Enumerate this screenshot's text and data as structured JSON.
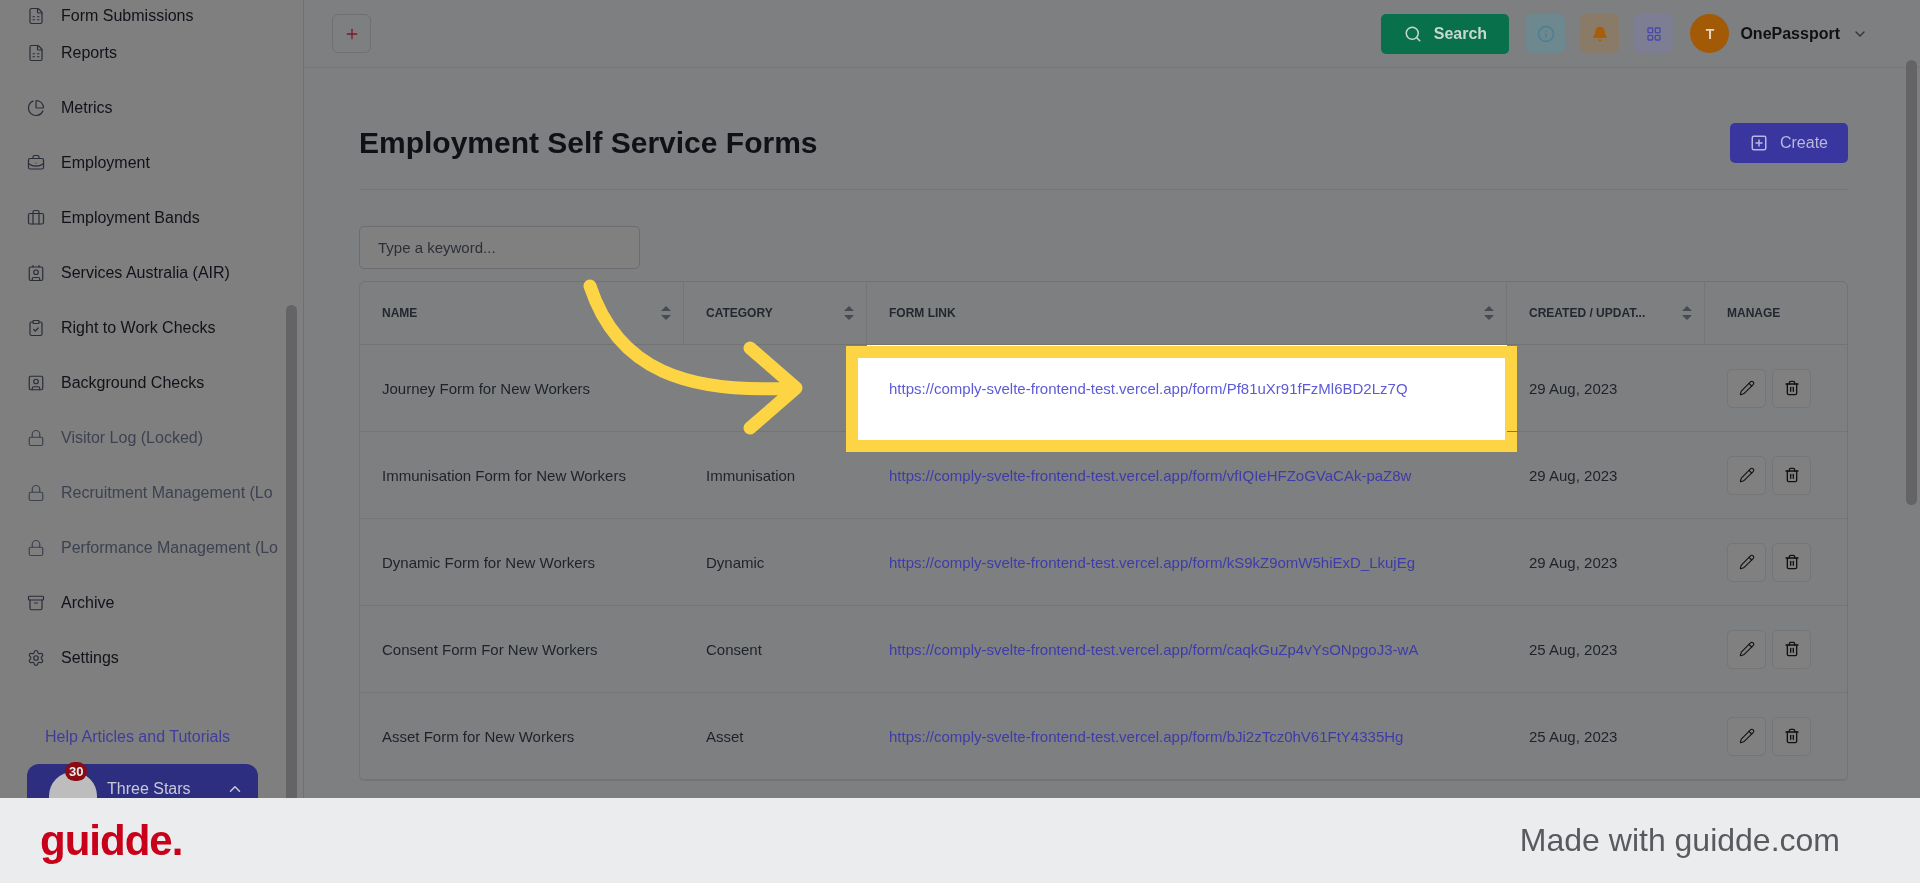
{
  "sidebar": {
    "items": [
      {
        "label": "Form Submissions",
        "locked": false
      },
      {
        "label": "Reports",
        "locked": false
      },
      {
        "label": "Metrics",
        "locked": false
      },
      {
        "label": "Employment",
        "locked": false
      },
      {
        "label": "Employment Bands",
        "locked": false
      },
      {
        "label": "Services Australia (AIR)",
        "locked": false
      },
      {
        "label": "Right to Work Checks",
        "locked": false
      },
      {
        "label": "Background Checks",
        "locked": false
      },
      {
        "label": "Visitor Log (Locked)",
        "locked": true
      },
      {
        "label": "Recruitment Management (Lo",
        "locked": true
      },
      {
        "label": "Performance Management (Lo",
        "locked": true
      },
      {
        "label": "Archive",
        "locked": false
      },
      {
        "label": "Settings",
        "locked": false
      }
    ],
    "help_link": "Help Articles and Tutorials",
    "promo": {
      "badge": "30",
      "title": "Three Stars"
    }
  },
  "topbar": {
    "search_label": "Search",
    "user": {
      "initial": "T",
      "name": "OnePassport"
    }
  },
  "page": {
    "title": "Employment Self Service Forms",
    "create_label": "Create",
    "search_placeholder": "Type a keyword..."
  },
  "table": {
    "columns": [
      {
        "label": "NAME",
        "sortable": true
      },
      {
        "label": "CATEGORY",
        "sortable": true
      },
      {
        "label": "FORM LINK",
        "sortable": true
      },
      {
        "label": "CREATED / UPDAT...",
        "sortable": true
      },
      {
        "label": "MANAGE",
        "sortable": false
      }
    ],
    "rows": [
      {
        "name": "Journey Form for New Workers",
        "category": "",
        "form_link": "https://comply-svelte-frontend-test.vercel.app/form/Pf81uXr91fFzMl6BD2Lz7Q",
        "created": "29 Aug, 2023",
        "highlighted": true
      },
      {
        "name": "Immunisation Form for New Workers",
        "category": "Immunisation",
        "form_link": "https://comply-svelte-frontend-test.vercel.app/form/vfIQIeHFZoGVaCAk-paZ8w",
        "created": "29 Aug, 2023",
        "highlighted": false
      },
      {
        "name": "Dynamic Form for New Workers",
        "category": "Dynamic",
        "form_link": "https://comply-svelte-frontend-test.vercel.app/form/kS9kZ9omW5hiExD_LkujEg",
        "created": "29 Aug, 2023",
        "highlighted": false
      },
      {
        "name": "Consent Form For New Workers",
        "category": "Consent",
        "form_link": "https://comply-svelte-frontend-test.vercel.app/form/caqkGuZp4vYsONpgoJ3-wA",
        "created": "25 Aug, 2023",
        "highlighted": false
      },
      {
        "name": "Asset Form for New Workers",
        "category": "Asset",
        "form_link": "https://comply-svelte-frontend-test.vercel.app/form/bJi2zTcz0hV61FtY4335Hg",
        "created": "25 Aug, 2023",
        "highlighted": false
      }
    ]
  },
  "footer": {
    "logo": "guidde.",
    "tagline": "Made with guidde.com"
  }
}
